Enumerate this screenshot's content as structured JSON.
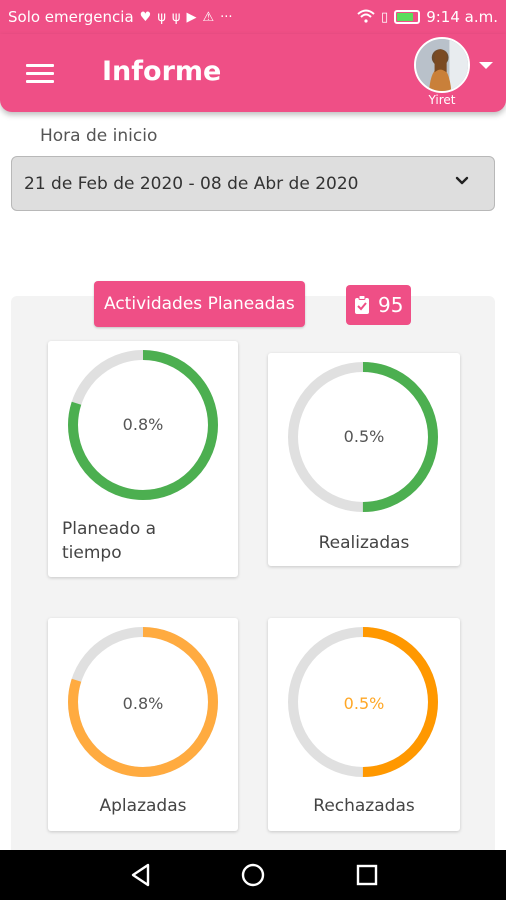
{
  "status_bar": {
    "carrier": "Solo emergencia",
    "time": "9:14 a.m."
  },
  "app_bar": {
    "title": "Informe",
    "user_name": "Yiret"
  },
  "filter": {
    "label": "Hora de inicio",
    "value": "21 de Feb de 2020 - 08 de Abr de 2020"
  },
  "summary": {
    "section_label": "Actividades Planeadas",
    "count": "95"
  },
  "cards": [
    {
      "label_line1": "Planeado a",
      "label_line2": "tiempo",
      "percent_text": "0.8%",
      "progress": 0.8,
      "color": "#4caf50"
    },
    {
      "label_line1": "Realizadas",
      "label_line2": "",
      "percent_text": "0.5%",
      "progress": 0.5,
      "color": "#4caf50"
    },
    {
      "label_line1": "Aplazadas",
      "label_line2": "",
      "percent_text": "0.8%",
      "progress": 0.8,
      "color": "#ffab40"
    },
    {
      "label_line1": "Rechazadas",
      "label_line2": "",
      "percent_text": "0.5%",
      "progress": 0.5,
      "color": "#ff9800"
    }
  ],
  "colors": {
    "brand": "#ef4f86",
    "track": "#e0e0e0"
  }
}
